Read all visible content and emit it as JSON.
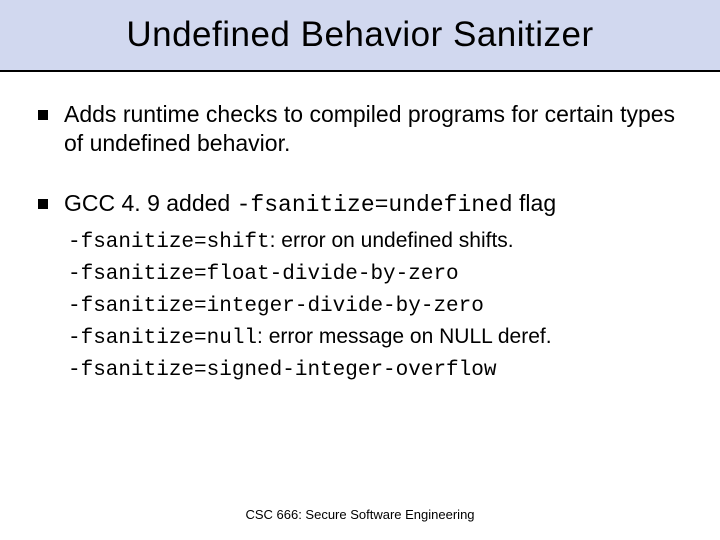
{
  "title": "Undefined Behavior Sanitizer",
  "bullets": {
    "b1": "Adds runtime checks to compiled programs for certain types of undefined behavior.",
    "b2_pre": "GCC 4. 9 added ",
    "b2_code": "-fsanitize=undefined",
    "b2_post": " flag"
  },
  "sub": {
    "s1_code": "-fsanitize=shift",
    "s1_text": ": error on undefined shifts.",
    "s2_code": "-fsanitize=float-divide-by-zero",
    "s3_code": "-fsanitize=integer-divide-by-zero",
    "s4_code": "-fsanitize=null",
    "s4_text": ": error message on NULL deref.",
    "s5_code": "-fsanitize=signed-integer-overflow"
  },
  "footer": "CSC 666: Secure Software Engineering"
}
